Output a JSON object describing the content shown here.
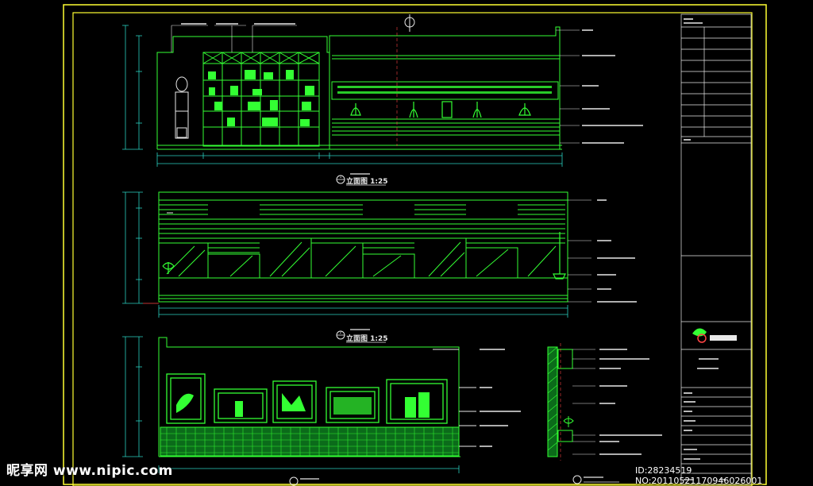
{
  "colors": {
    "background": "#000000",
    "border": "#ffff33",
    "line": "#33ff33",
    "dim": "#2ad0c0",
    "label": "#e8e8e8",
    "accent": "#ff4444"
  },
  "sheet": {
    "elevation_1": {
      "title": "立面图 1:25",
      "number": "1"
    },
    "elevation_2": {
      "title": "立面图 1:25",
      "number": "2"
    }
  },
  "watermark": {
    "site": "昵享网 www.nipic.com",
    "id": "ID:28234519 NO:20110521170946026001"
  }
}
